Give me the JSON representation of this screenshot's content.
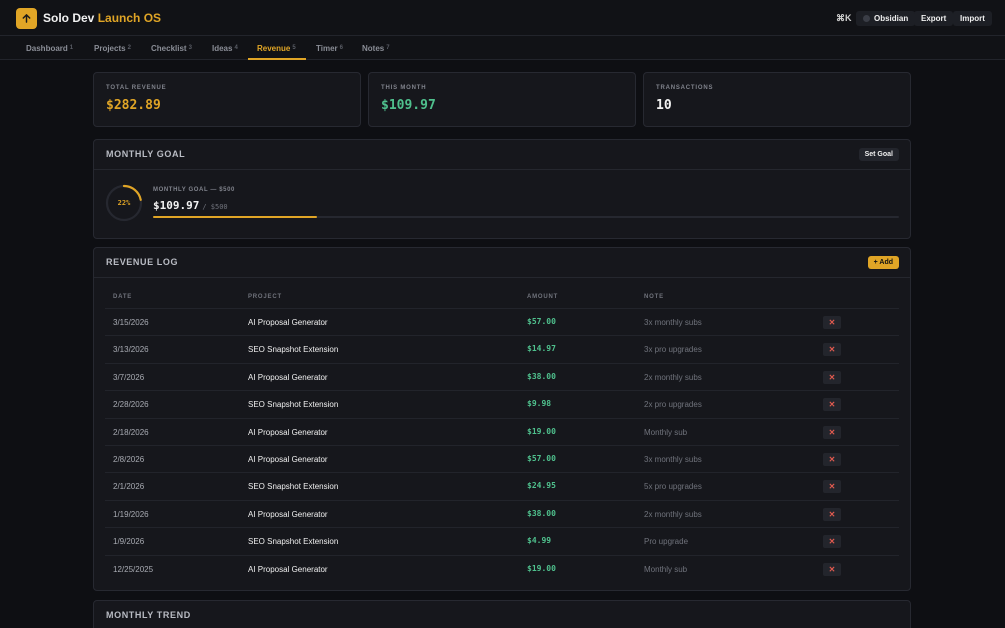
{
  "header": {
    "brand_primary": "Solo Dev",
    "brand_accent": "Launch OS",
    "shortcut": "⌘K",
    "obsidian_label": "Obsidian",
    "export_label": "Export",
    "import_label": "Import"
  },
  "tabs": [
    {
      "label": "Dashboard",
      "key": "1"
    },
    {
      "label": "Projects",
      "key": "2"
    },
    {
      "label": "Checklist",
      "key": "3"
    },
    {
      "label": "Ideas",
      "key": "4"
    },
    {
      "label": "Revenue",
      "key": "5"
    },
    {
      "label": "Timer",
      "key": "6"
    },
    {
      "label": "Notes",
      "key": "7"
    }
  ],
  "stats": {
    "total_label": "Total Revenue",
    "total_value": "$282.89",
    "month_label": "This Month",
    "month_value": "$109.97",
    "tx_label": "Transactions",
    "tx_value": "10"
  },
  "goal": {
    "title": "Monthly Goal",
    "set_label": "Set Goal",
    "percent_text": "22%",
    "progress_fraction": 0.22,
    "subtitle": "Monthly Goal — $500",
    "amount": "$109.97",
    "of_text": "/ $500"
  },
  "log": {
    "title": "Revenue Log",
    "add_label": "+ Add",
    "columns": {
      "date": "Date",
      "project": "Project",
      "amount": "Amount",
      "note": "Note"
    },
    "delete_glyph": "✕",
    "rows": [
      {
        "date": "3/15/2026",
        "project": "AI Proposal Generator",
        "amount": "$57.00",
        "note": "3x monthly subs"
      },
      {
        "date": "3/13/2026",
        "project": "SEO Snapshot Extension",
        "amount": "$14.97",
        "note": "3x pro upgrades"
      },
      {
        "date": "3/7/2026",
        "project": "AI Proposal Generator",
        "amount": "$38.00",
        "note": "2x monthly subs"
      },
      {
        "date": "2/28/2026",
        "project": "SEO Snapshot Extension",
        "amount": "$9.98",
        "note": "2x pro upgrades"
      },
      {
        "date": "2/18/2026",
        "project": "AI Proposal Generator",
        "amount": "$19.00",
        "note": "Monthly sub"
      },
      {
        "date": "2/8/2026",
        "project": "AI Proposal Generator",
        "amount": "$57.00",
        "note": "3x monthly subs"
      },
      {
        "date": "2/1/2026",
        "project": "SEO Snapshot Extension",
        "amount": "$24.95",
        "note": "5x pro upgrades"
      },
      {
        "date": "1/19/2026",
        "project": "AI Proposal Generator",
        "amount": "$38.00",
        "note": "2x monthly subs"
      },
      {
        "date": "1/9/2026",
        "project": "SEO Snapshot Extension",
        "amount": "$4.99",
        "note": "Pro upgrade"
      },
      {
        "date": "12/25/2025",
        "project": "AI Proposal Generator",
        "amount": "$19.00",
        "note": "Monthly sub"
      }
    ]
  },
  "trend": {
    "title": "Monthly Trend"
  },
  "colors": {
    "accent": "#e0a526",
    "positive": "#4fc08d",
    "danger": "#e05a4f",
    "background": "#0e0f13"
  }
}
